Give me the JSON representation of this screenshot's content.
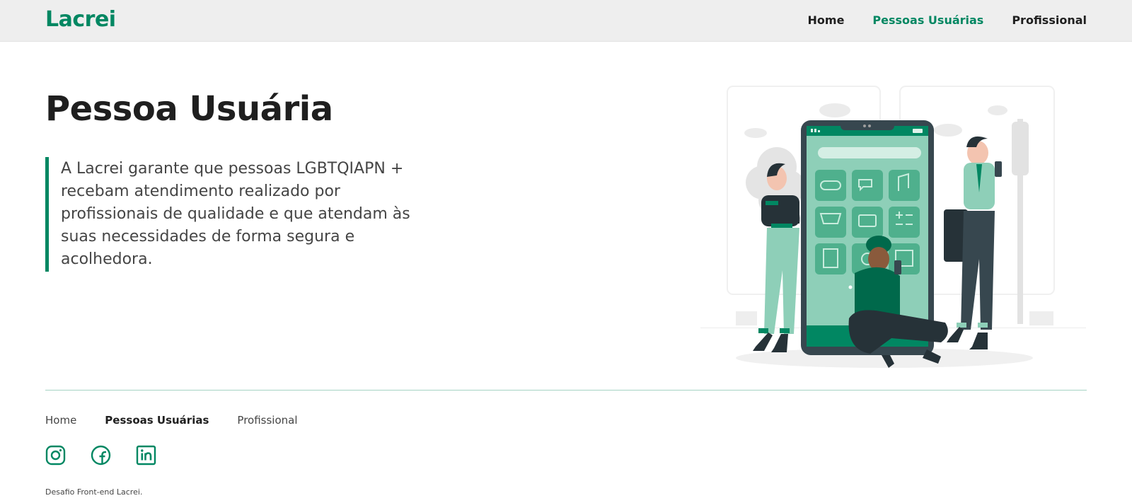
{
  "header": {
    "logo": "Lacrei",
    "nav": [
      {
        "label": "Home"
      },
      {
        "label": "Pessoas Usuárias",
        "active": true
      },
      {
        "label": "Profissional"
      }
    ]
  },
  "main": {
    "title": "Pessoa Usuária",
    "description": "A Lacrei garante que pessoas LGBTQIAPN + recebam atendimento realizado por profissionais de qualidade e que atendam às suas necessidades de forma segura e acolhedora.",
    "illustration_icon": "people-using-phone-illustration"
  },
  "footer": {
    "nav": [
      {
        "label": "Home"
      },
      {
        "label": "Pessoas Usuárias",
        "active": true
      },
      {
        "label": "Profissional"
      }
    ],
    "social": [
      {
        "icon": "instagram-icon"
      },
      {
        "icon": "facebook-icon"
      },
      {
        "icon": "linkedin-icon"
      }
    ],
    "credit": "Desafio Front-end Lacrei."
  },
  "colors": {
    "brand": "#018762",
    "text": "#1f1f1f",
    "text_muted": "#454545",
    "header_bg": "#eeeeee",
    "divider": "#a6d4c4",
    "illustration_light": "#8ecfb8",
    "illustration_dark": "#263238"
  }
}
